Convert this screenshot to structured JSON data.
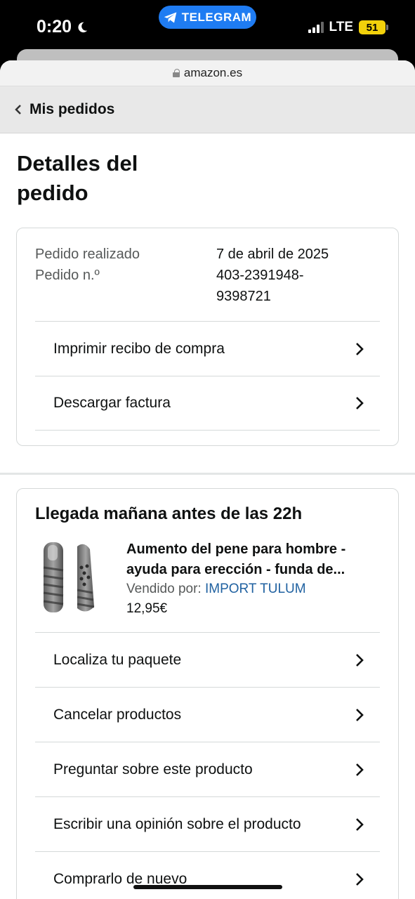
{
  "status_bar": {
    "time": "0:20",
    "pill_label": "TELEGRAM",
    "network": "LTE",
    "battery": "51"
  },
  "browser": {
    "url": "amazon.es"
  },
  "nav": {
    "back_label": "Mis pedidos"
  },
  "page": {
    "title": "Detalles del pedido"
  },
  "order": {
    "placed_label": "Pedido realizado",
    "placed_value": "7 de abril de 2025",
    "number_label": "Pedido n.º",
    "number_value": "403-2391948-9398721",
    "actions": [
      {
        "label": "Imprimir recibo de compra"
      },
      {
        "label": "Descargar factura"
      }
    ]
  },
  "shipment": {
    "heading": "Llegada mañana antes de las 22h",
    "product": {
      "title_line1": "Aumento del pene para hombre -",
      "title_line2": "ayuda para erección - funda de...",
      "seller_prefix": "Vendido por:",
      "seller_name": "IMPORT TULUM",
      "price": "12,95€"
    },
    "actions": [
      {
        "label": "Localiza tu paquete"
      },
      {
        "label": "Cancelar productos"
      },
      {
        "label": "Preguntar sobre este producto"
      },
      {
        "label": "Escribir una opinión sobre el producto"
      },
      {
        "label": "Comprarlo de nuevo"
      }
    ]
  },
  "colors": {
    "link": "#2162a1",
    "telegram_pill": "#1f7cf2",
    "battery": "#f2d10b"
  },
  "icons": {
    "moon": "moon-icon",
    "telegram": "telegram-icon",
    "lock": "lock-icon",
    "back": "chevron-left-icon",
    "row_arrow": "chevron-right-icon"
  }
}
